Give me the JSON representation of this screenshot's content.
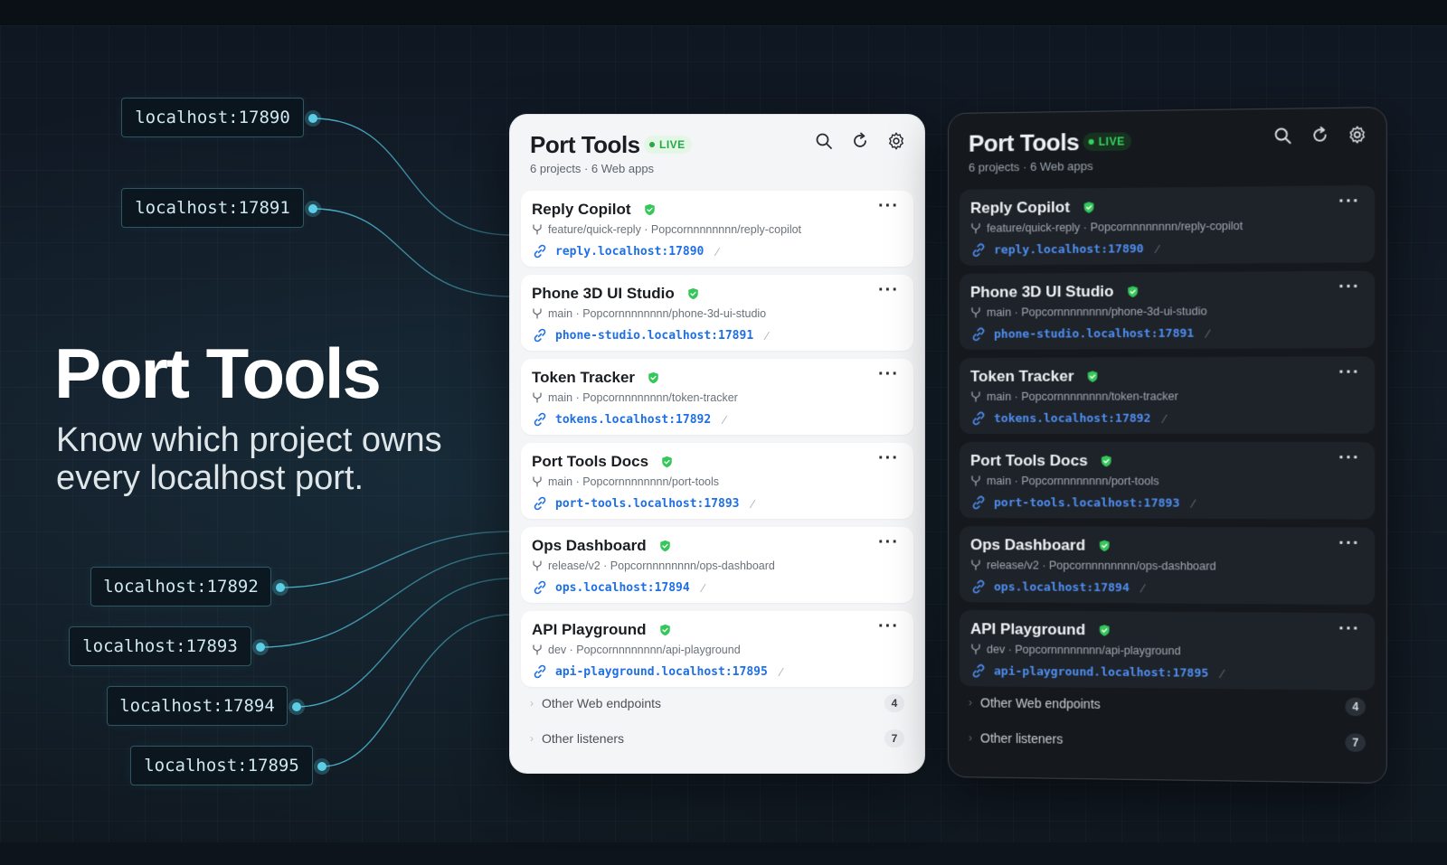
{
  "hero": {
    "title": "Port Tools",
    "subtitle_line1": "Know which project owns",
    "subtitle_line2": "every localhost port."
  },
  "ports": [
    "localhost:17890",
    "localhost:17891",
    "localhost:17892",
    "localhost:17893",
    "localhost:17894",
    "localhost:17895"
  ],
  "app": {
    "title": "Port Tools",
    "live_label": "LIVE",
    "summary": "6 projects · 6 Web apps",
    "tools": {
      "search_icon": "search-icon",
      "refresh_icon": "refresh-icon",
      "settings_icon": "gear-icon"
    },
    "projects": [
      {
        "name": "Reply Copilot",
        "branch": "feature/quick-reply · Popcornnnnnnnn/reply-copilot",
        "url": "reply.localhost:17890"
      },
      {
        "name": "Phone 3D UI Studio",
        "branch": "main · Popcornnnnnnnn/phone-3d-ui-studio",
        "url": "phone-studio.localhost:17891"
      },
      {
        "name": "Token Tracker",
        "branch": "main · Popcornnnnnnnn/token-tracker",
        "url": "tokens.localhost:17892"
      },
      {
        "name": "Port Tools Docs",
        "branch": "main · Popcornnnnnnnn/port-tools",
        "url": "port-tools.localhost:17893"
      },
      {
        "name": "Ops Dashboard",
        "branch": "release/v2 · Popcornnnnnnnn/ops-dashboard",
        "url": "ops.localhost:17894"
      },
      {
        "name": "API Playground",
        "branch": "dev · Popcornnnnnnnn/api-playground",
        "url": "api-playground.localhost:17895"
      }
    ],
    "more_label": "···",
    "edit_glyph": "⁄",
    "footer": [
      {
        "label": "Other Web endpoints",
        "count": "4"
      },
      {
        "label": "Other listeners",
        "count": "7"
      }
    ],
    "colors": {
      "accent_blue": "#1f6fe5",
      "live_green": "#28a745",
      "wire_cyan": "#4fc3dd"
    }
  }
}
